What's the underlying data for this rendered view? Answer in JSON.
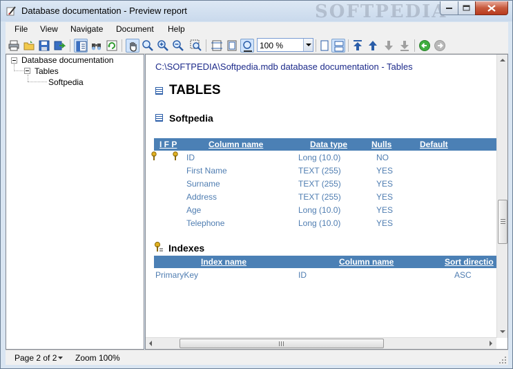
{
  "window": {
    "title": "Database documentation - Preview report",
    "watermark": "SOFTPEDIA"
  },
  "menu": [
    "File",
    "View",
    "Navigate",
    "Document",
    "Help"
  ],
  "toolbar": {
    "zoom_value": "100 %",
    "icons": [
      "print-icon",
      "open-icon",
      "save-icon",
      "export-icon",
      "toggle-tree-icon",
      "find-icon",
      "refresh-icon",
      "hand-tool-icon",
      "zoom-in-icon",
      "zoom-in-icon",
      "zoom-out-icon",
      "zoom-rect-icon",
      "fit-width-icon",
      "fit-page-icon",
      "zoom-100-icon",
      "single-page-icon",
      "two-page-icon",
      "first-page-icon",
      "prev-page-icon",
      "next-page-icon",
      "last-page-icon",
      "back-icon",
      "forward-icon"
    ]
  },
  "tree": {
    "root": "Database documentation",
    "child": "Tables",
    "leaf": "Softpedia"
  },
  "document": {
    "path": "C:\\SOFTPEDIA\\Softpedia.mdb database documentation - Tables",
    "heading": "TABLES",
    "table_name": "Softpedia",
    "columns_header": {
      "flags": "I F P",
      "name": "Column name",
      "type": "Data type",
      "nulls": "Nulls",
      "default": "Default"
    },
    "columns": [
      {
        "name": "ID",
        "type": "Long (10.0)",
        "nulls": "NO"
      },
      {
        "name": "First Name",
        "type": "TEXT (255)",
        "nulls": "YES"
      },
      {
        "name": "Surname",
        "type": "TEXT (255)",
        "nulls": "YES"
      },
      {
        "name": "Address",
        "type": "TEXT (255)",
        "nulls": "YES"
      },
      {
        "name": "Age",
        "type": "Long (10.0)",
        "nulls": "YES"
      },
      {
        "name": "Telephone",
        "type": "Long (10.0)",
        "nulls": "YES"
      }
    ],
    "indexes_heading": "Indexes",
    "index_header": {
      "index": "Index name",
      "column": "Column name",
      "sort": "Sort directio"
    },
    "indexes": [
      {
        "index": "PrimaryKey",
        "column": "ID",
        "sort": "ASC"
      }
    ]
  },
  "status": {
    "page": "Page 2 of 2",
    "zoom": "Zoom 100%"
  }
}
